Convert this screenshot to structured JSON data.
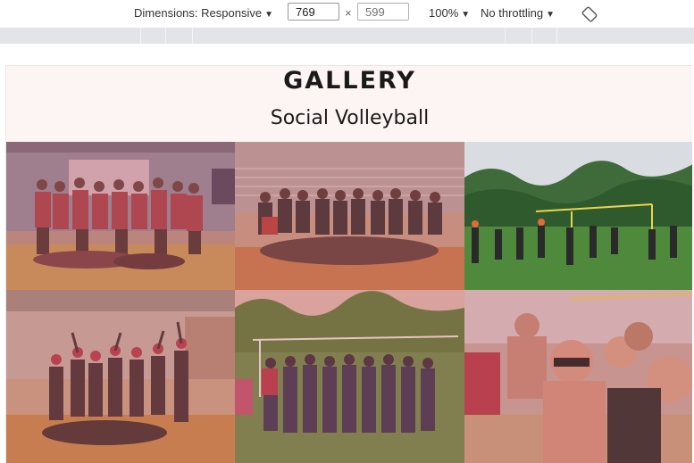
{
  "devtools": {
    "dimensions_label": "Dimensions: Responsive",
    "width_value": "769",
    "height_placeholder": "599",
    "times_symbol": "×",
    "zoom": "100%",
    "throttling": "No throttling",
    "caret": "▼",
    "rotate_icon": "rotate-icon"
  },
  "page": {
    "title": "GALLERY",
    "subtitle": "Social Volleyball"
  },
  "gallery": {
    "photos": [
      {
        "name": "indoor-group-photo",
        "tint": "#c75f5f"
      },
      {
        "name": "indoor-team-photo",
        "tint": "#c75f5f"
      },
      {
        "name": "outdoor-game-photo",
        "tint": "none"
      },
      {
        "name": "christmas-group-photo",
        "tint": "#c75f5f"
      },
      {
        "name": "park-group-photo",
        "tint": "#c75f5f"
      },
      {
        "name": "beach-selfie-photo",
        "tint": "#c75f5f"
      }
    ]
  },
  "colors": {
    "overlay_tint": "#c75f5f",
    "page_background": "#fdf5f3",
    "toolbar_ruler": "#e2e4e7"
  }
}
